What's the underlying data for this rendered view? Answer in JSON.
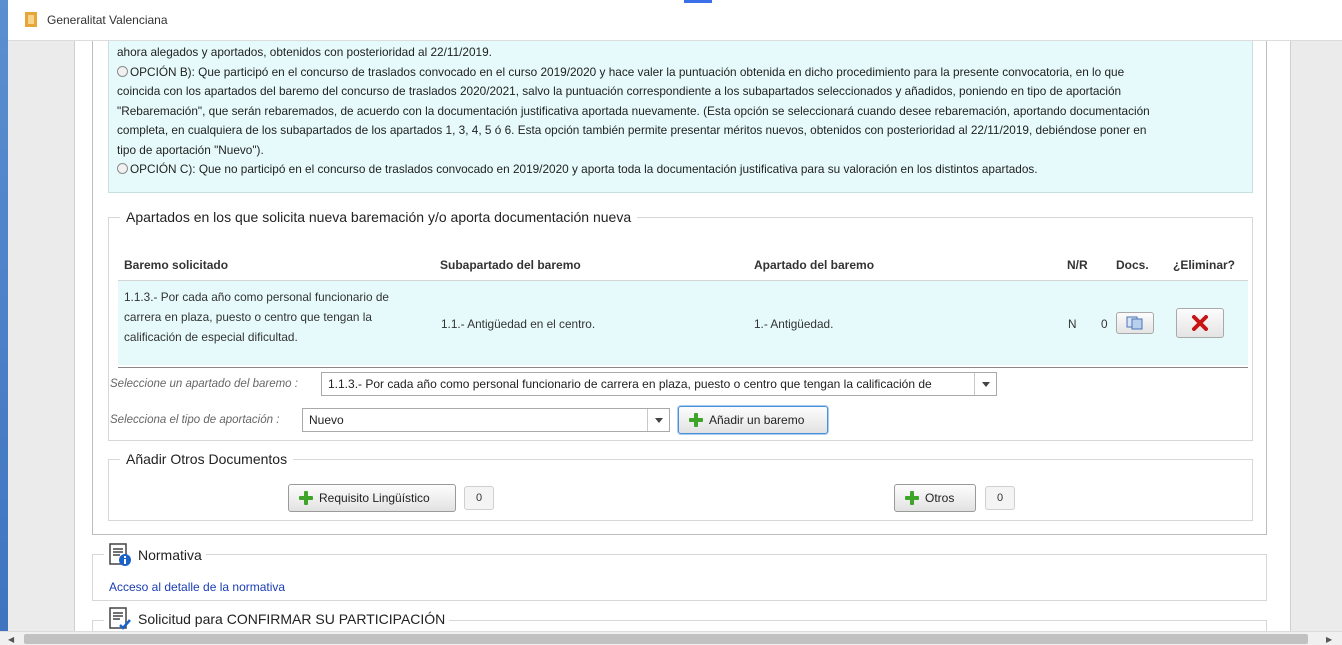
{
  "window": {
    "title": "Generalitat Valenciana"
  },
  "options": {
    "line0": "ahora alegados y aportados, obtenidos con posterioridad al 22/11/2019.",
    "b_lines": [
      "OPCIÓN B): Que participó en el concurso de traslados convocado en el curso 2019/2020 y hace valer la puntuación obtenida en dicho procedimiento para la presente convocatoria, en lo que",
      "coincida con los apartados del baremo del concurso de traslados 2020/2021, salvo la puntuación correspondiente a los subapartados seleccionados y añadidos, poniendo en tipo de aportación",
      "\"Rebaremación\", que serán rebaremados, de acuerdo con la documentación justificativa aportada nuevamente. (Esta opción se seleccionará cuando desee rebaremación, aportando documentación",
      "completa, en cualquiera de los subapartados de los apartados 1, 3, 4, 5 ó 6. Esta opción también permite presentar méritos nuevos, obtenidos con posterioridad al 22/11/2019, debiéndose poner en",
      "tipo de aportación \"Nuevo\")."
    ],
    "c_line": "OPCIÓN C): Que no participó en el concurso de traslados convocado en 2019/2020 y aporta toda la documentación justificativa para su valoración en los distintos apartados."
  },
  "baremo_section": {
    "legend": "Apartados en los que solicita nueva baremación y/o aporta documentación nueva",
    "headers": {
      "baremo": "Baremo solicitado",
      "subapartado": "Subapartado del baremo",
      "apartado": "Apartado del baremo",
      "nr": "N/R",
      "docs": "Docs.",
      "eliminar": "¿Eliminar?"
    },
    "rows": [
      {
        "baremo_lines": [
          "1.1.3.- Por cada año como personal funcionario de",
          "carrera en plaza, puesto o centro que tengan la",
          "calificación de especial dificultad."
        ],
        "subapartado": "1.1.- Antigüedad en el centro.",
        "apartado": "1.- Antigüedad.",
        "nr": "N",
        "docs_count": "0"
      }
    ],
    "select_apartado_label": "Seleccione un apartado del baremo :",
    "select_apartado_value": "1.1.3.- Por cada año como personal funcionario de carrera en plaza, puesto o centro que tengan la calificación de",
    "select_tipo_label": "Selecciona el tipo de aportación :",
    "select_tipo_value": "Nuevo",
    "add_button": "Añadir un baremo"
  },
  "otros_section": {
    "legend": "Añadir Otros Documentos",
    "requisito_button": "Requisito Lingüístico",
    "requisito_count": "0",
    "otros_button": "Otros",
    "otros_count": "0"
  },
  "normativa": {
    "title": "Normativa",
    "link": "Acceso al detalle de la normativa"
  },
  "confirmar": {
    "title": "Solicitud para CONFIRMAR SU PARTICIPACIÓN"
  },
  "colors": {
    "accent": "#3a6fe8",
    "row_bg": "#e6fafb",
    "delete_red": "#c81414",
    "plus_green": "#3fa52a",
    "link": "#1a3db4"
  }
}
